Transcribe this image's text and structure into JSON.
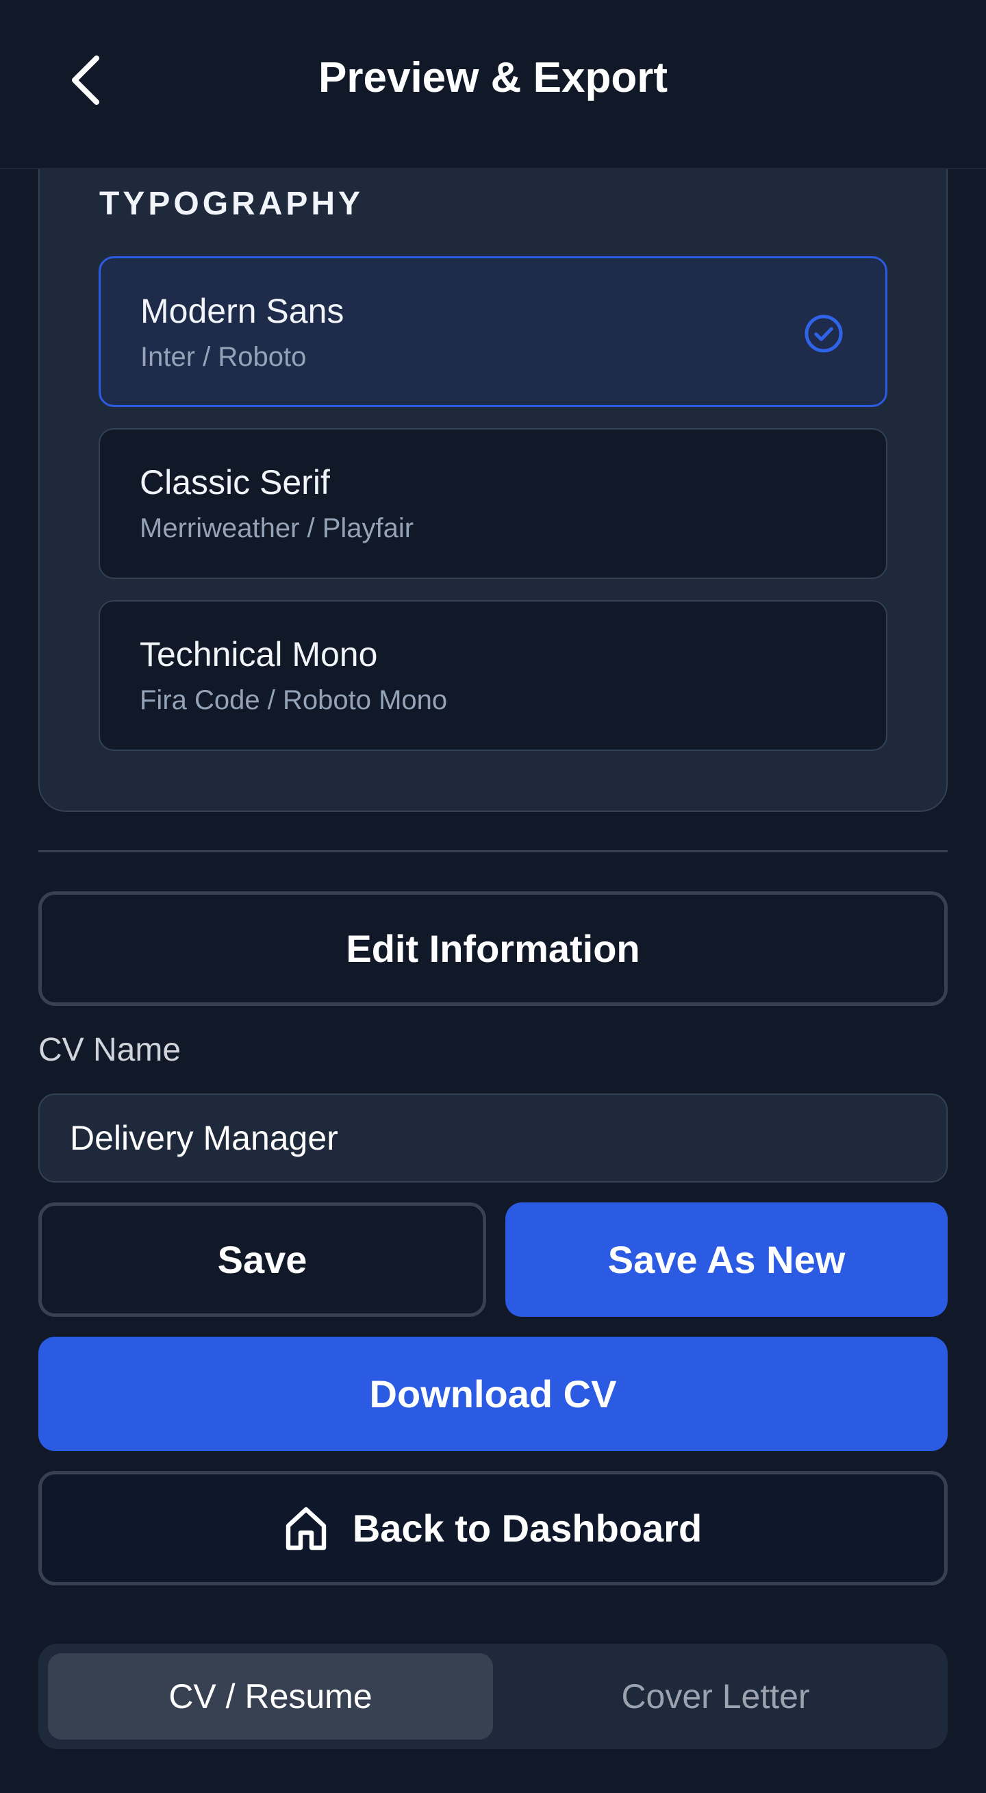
{
  "header": {
    "title": "Preview & Export",
    "back_icon": "chevron-left-icon"
  },
  "typography": {
    "heading": "TYPOGRAPHY",
    "options": [
      {
        "name": "Modern Sans",
        "fonts": "Inter / Roboto",
        "selected": true
      },
      {
        "name": "Classic Serif",
        "fonts": "Merriweather / Playfair",
        "selected": false
      },
      {
        "name": "Technical Mono",
        "fonts": "Fira Code / Roboto Mono",
        "selected": false
      }
    ],
    "selected_icon": "check-circle-icon"
  },
  "actions": {
    "edit_label": "Edit Information",
    "cv_name_label": "CV Name",
    "cv_name_value": "Delivery Manager",
    "save_label": "Save",
    "save_as_new_label": "Save As New",
    "download_label": "Download CV",
    "dashboard_label": "Back to Dashboard",
    "dashboard_icon": "home-icon"
  },
  "tabs": {
    "items": [
      {
        "label": "CV / Resume",
        "active": true
      },
      {
        "label": "Cover Letter",
        "active": false
      }
    ]
  },
  "colors": {
    "background": "#111827",
    "card": "#1e293b",
    "accent": "#2b5be3",
    "border": "#374151"
  }
}
